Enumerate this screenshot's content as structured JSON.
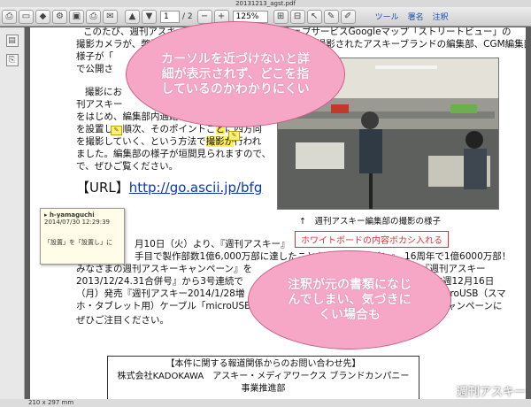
{
  "window": {
    "title": "20131213_agst.pdf"
  },
  "toolbar": {
    "page_current": "1",
    "page_total": "/ 2",
    "zoom": "125%",
    "tools_label": "ツール",
    "sign_label": "署名",
    "comment_label": "注釈"
  },
  "statusbar": {
    "page_size": "210 x 297 mm"
  },
  "doc": {
    "line1": "このたび、週刊アスキーは、Googleが提供するウェブサービスGoogleマップ「ストリートビュー」の",
    "line2": "撮影カメラが、弊社のオフィスにやってきました。そこで撮影されたアスキーブランドの編集部、CGM編集部の",
    "line3": "様子が「",
    "line4": "で公開さ",
    "line5": "撮影にお",
    "line6": "刊アスキー",
    "line7": "をはじめ、編集部内通路の区切りごとにカメラ",
    "line8a": "を設置し、順次、そのポイントご",
    "line8b": "と",
    "line8c": "に四方向",
    "line9a": "を撮影していく、という方法で",
    "line9b": "撮影が",
    "line9c": "行われ",
    "line10": "ました。編集部の様子が垣間見られますので、",
    "line11": "で、ぜひご覧ください。",
    "url_label": "【URL】",
    "url": "http://go.ascii.jp/bfg",
    "line12": "月10日（火）より、『週刊アスキー』",
    "line13": "手目で製作部数1億6,000万部に達したことを祝う『キリバン』　16周年で1億6000万部！",
    "line14": "みなさまの週刊アスキーキャンペーン』を",
    "line14b": "発売『週刊アスキー",
    "line15": "2013/12/24.31合併号』から3号連続で",
    "line15b": "。次週12月16日",
    "line16": "（月）発売『週刊アスキー2014/1/28増",
    "line16b": "3MicroUSB（スマ",
    "line17": "ホ・タブレット用）ケーブル「microUSBひ",
    "line17b": "本キャンペーンに",
    "line18": "ぜひご注目ください。",
    "photo_caption": "↑　週刊アスキー編集部の撮影の様子",
    "footer_line1": "【本件に関する報道関係からのお問い合わせ先】",
    "footer_line2": "株式会社KADOKAWA　アスキー・メディアワークス ブランドカンパニー",
    "footer_line3": "事業推進部"
  },
  "annotations": {
    "redbox_text": "ホワイトボードの内容ボカシ入れる",
    "note_author": "h-yamaguchi",
    "note_date": "2014/07/30 12:29:39",
    "note_body": "「設置」を「設置し」に"
  },
  "callouts": {
    "top": "カーソルを近づけないと詳細が表示されず、どこを指しているのかわかりにくい",
    "bottom": "注釈が元の書類になじんでしまい、気づきにくい場合も"
  },
  "watermark": "週刊アスキー"
}
